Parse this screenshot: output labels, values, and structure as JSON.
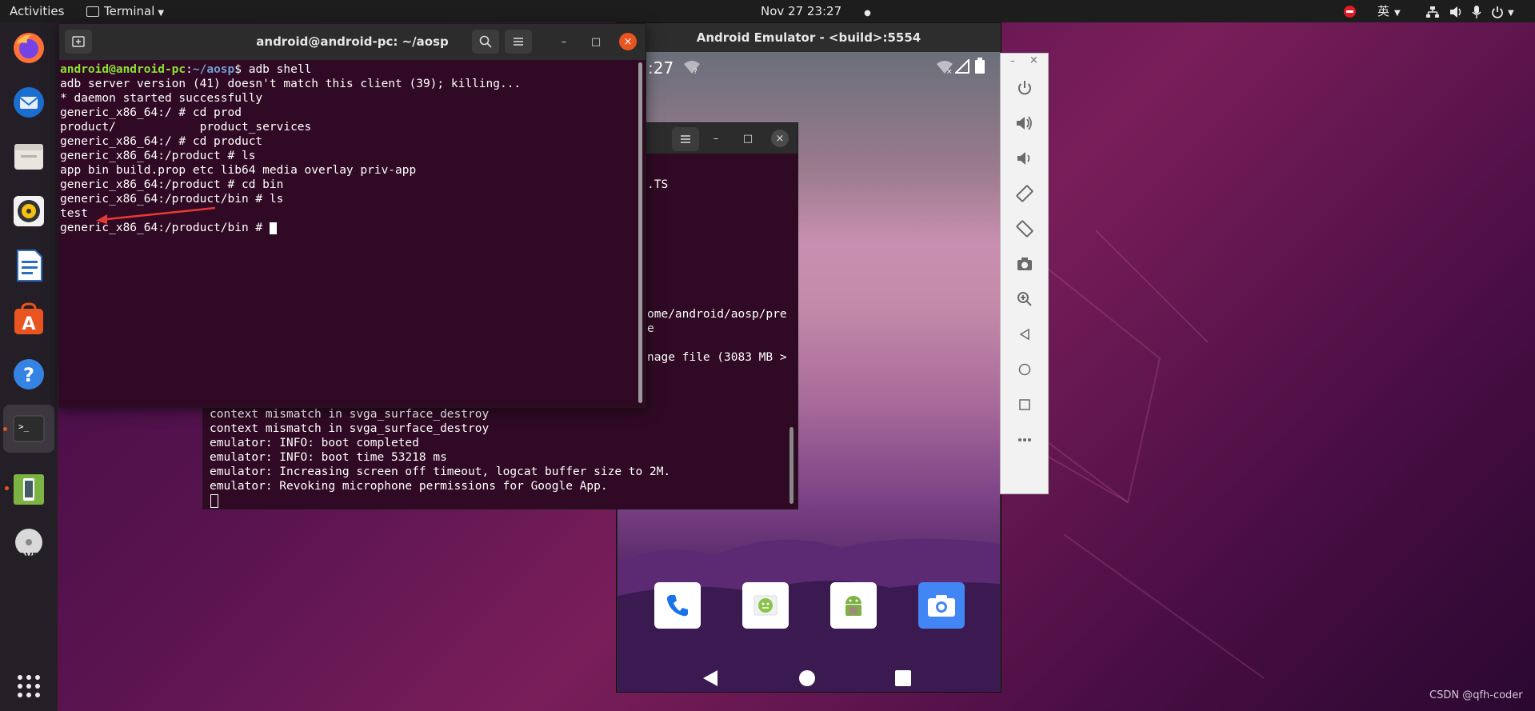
{
  "topbar": {
    "activities": "Activities",
    "app_menu": "Terminal",
    "datetime": "Nov 27  23:27",
    "input_method": "英"
  },
  "emulator": {
    "title": "Android Emulator - <build>:5554",
    "status_time": ":27",
    "nav": [
      "back",
      "home",
      "recents"
    ]
  },
  "terminal_main": {
    "title": "android@android-pc: ~/aosp",
    "prompt_user": "android@android-pc",
    "prompt_path": "~/aosp",
    "lines": [
      "adb server version (41) doesn't match this client (39); killing...",
      "* daemon started successfully",
      "generic_x86_64:/ # cd prod",
      "product/            product_services",
      "generic_x86_64:/ # cd product",
      "generic_x86_64:/product # ls",
      "app bin build.prop etc lib64 media overlay priv-app",
      "generic_x86_64:/product # cd bin",
      "generic_x86_64:/product/bin # ls",
      "test",
      "generic_x86_64:/product/bin # "
    ],
    "first_command": "$ adb shell"
  },
  "terminal_bg": {
    "peek_lines": [
      ".TS",
      "ome/android/aosp/pre",
      "e",
      "nage file (3083 MB >"
    ],
    "lines": [
      "context mismatch in svga_surface_destroy",
      "context mismatch in svga_surface_destroy",
      "emulator: INFO: boot completed",
      "emulator: INFO: boot time 53218 ms",
      "emulator: Increasing screen off timeout, logcat buffer size to 2M.",
      "emulator: Revoking microphone permissions for Google App."
    ]
  },
  "watermark": "CSDN @qfh-coder",
  "colors": {
    "terminal_bg": "#300a24",
    "prompt_green": "#8ae234",
    "prompt_blue": "#729fcf",
    "close_orange": "#e95420",
    "arrow_red": "#e53935"
  }
}
